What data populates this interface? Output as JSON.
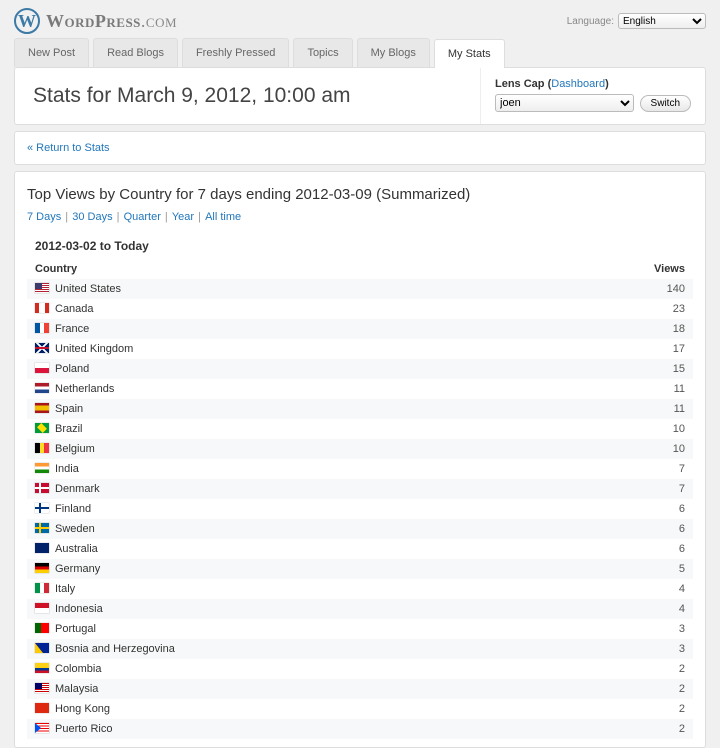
{
  "brand": {
    "name": "WordPress",
    "suffix": ".com"
  },
  "language": {
    "label": "Language:",
    "selected": "English"
  },
  "nav": {
    "tabs": [
      {
        "label": "New Post"
      },
      {
        "label": "Read Blogs"
      },
      {
        "label": "Freshly Pressed"
      },
      {
        "label": "Topics"
      },
      {
        "label": "My Blogs"
      },
      {
        "label": "My Stats"
      }
    ],
    "active_index": 5
  },
  "header": {
    "title": "Stats for March 9, 2012, 10:00 am",
    "blog_label": "Lens Cap",
    "dashboard_link": "Dashboard",
    "user_selected": "joen",
    "switch_label": "Switch"
  },
  "return_link": "« Return to Stats",
  "summary": {
    "title": "Top Views by Country for 7 days ending 2012-03-09 (Summarized)",
    "ranges": [
      {
        "label": "7 Days"
      },
      {
        "label": "30 Days"
      },
      {
        "label": "Quarter"
      },
      {
        "label": "Year"
      },
      {
        "label": "All time"
      }
    ],
    "period": "2012-03-02 to Today",
    "col_country": "Country",
    "col_views": "Views",
    "rows": [
      {
        "flag": "us",
        "country": "United States",
        "views": 140
      },
      {
        "flag": "ca",
        "country": "Canada",
        "views": 23
      },
      {
        "flag": "fr",
        "country": "France",
        "views": 18
      },
      {
        "flag": "gb",
        "country": "United Kingdom",
        "views": 17
      },
      {
        "flag": "pl",
        "country": "Poland",
        "views": 15
      },
      {
        "flag": "nl",
        "country": "Netherlands",
        "views": 11
      },
      {
        "flag": "es",
        "country": "Spain",
        "views": 11
      },
      {
        "flag": "br",
        "country": "Brazil",
        "views": 10
      },
      {
        "flag": "be",
        "country": "Belgium",
        "views": 10
      },
      {
        "flag": "in",
        "country": "India",
        "views": 7
      },
      {
        "flag": "dk",
        "country": "Denmark",
        "views": 7
      },
      {
        "flag": "fi",
        "country": "Finland",
        "views": 6
      },
      {
        "flag": "se",
        "country": "Sweden",
        "views": 6
      },
      {
        "flag": "au",
        "country": "Australia",
        "views": 6
      },
      {
        "flag": "de",
        "country": "Germany",
        "views": 5
      },
      {
        "flag": "it",
        "country": "Italy",
        "views": 4
      },
      {
        "flag": "id",
        "country": "Indonesia",
        "views": 4
      },
      {
        "flag": "pt",
        "country": "Portugal",
        "views": 3
      },
      {
        "flag": "ba",
        "country": "Bosnia and Herzegovina",
        "views": 3
      },
      {
        "flag": "co",
        "country": "Colombia",
        "views": 2
      },
      {
        "flag": "my",
        "country": "Malaysia",
        "views": 2
      },
      {
        "flag": "hk",
        "country": "Hong Kong",
        "views": 2
      },
      {
        "flag": "pr",
        "country": "Puerto Rico",
        "views": 2
      }
    ]
  }
}
